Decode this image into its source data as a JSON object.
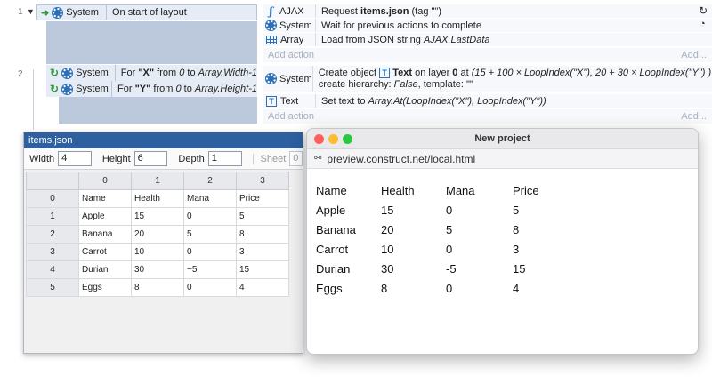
{
  "event1": {
    "number": "1",
    "condition": {
      "object": "System",
      "text": "On start of layout"
    },
    "actions": [
      {
        "object": "AJAX",
        "text_prefix": "Request ",
        "text_bold": "items.json",
        "text_suffix": " (tag \"\")"
      },
      {
        "object": "System",
        "text": "Wait for previous actions to complete"
      },
      {
        "object": "Array",
        "text_prefix": "Load from JSON string ",
        "text_italic": "AJAX.LastData"
      }
    ],
    "add_action": "Add action",
    "add_short": "Add..."
  },
  "event2": {
    "number": "2",
    "conditions": [
      {
        "object": "System",
        "p1": "For ",
        "bold": "\"X\"",
        "p2": " from ",
        "it1": "0",
        "p3": " to ",
        "it2": "Array.Width-1"
      },
      {
        "object": "System",
        "p1": "For ",
        "bold": "\"Y\"",
        "p2": " from ",
        "it1": "0",
        "p3": " to ",
        "it2": "Array.Height-1"
      }
    ],
    "actions": [
      {
        "object": "System",
        "line1_a": "Create object ",
        "line1_b": "Text",
        "line1_c": " on layer ",
        "line1_d": "0",
        "line1_e": " at ",
        "line1_f": "(15 + 100 × LoopIndex(\"X\"), 20 + 30 × LoopIndex(\"Y\") )",
        "line1_g": ",",
        "line2_a": "create hierarchy: ",
        "line2_b": "False",
        "line2_c": ", template: \"\""
      },
      {
        "object": "Text",
        "text_prefix": "Set text to ",
        "text_italic": "Array.At(LoopIndex(\"X\"), LoopIndex(\"Y\"))"
      }
    ],
    "add_action": "Add action",
    "add_short": "Add..."
  },
  "array_editor": {
    "title": "items.json",
    "width_label": "Width",
    "width_value": "4",
    "height_label": "Height",
    "height_value": "6",
    "depth_label": "Depth",
    "depth_value": "1",
    "sheet_label": "Sheet",
    "sheet_value": "0",
    "columns": [
      "0",
      "1",
      "2",
      "3"
    ],
    "rows": [
      {
        "index": "0",
        "cells": [
          "Name",
          "Health",
          "Mana",
          "Price"
        ]
      },
      {
        "index": "1",
        "cells": [
          "Apple",
          "15",
          "0",
          "5"
        ]
      },
      {
        "index": "2",
        "cells": [
          "Banana",
          "20",
          "5",
          "8"
        ]
      },
      {
        "index": "3",
        "cells": [
          "Carrot",
          "10",
          "0",
          "3"
        ]
      },
      {
        "index": "4",
        "cells": [
          "Durian",
          "30",
          "−5",
          "15"
        ]
      },
      {
        "index": "5",
        "cells": [
          "Eggs",
          "8",
          "0",
          "4"
        ]
      }
    ]
  },
  "preview": {
    "title": "New project",
    "url": "preview.construct.net/local.html",
    "table": [
      [
        "Name",
        "Health",
        "Mana",
        "Price"
      ],
      [
        "Apple",
        "15",
        "0",
        "5"
      ],
      [
        "Banana",
        "20",
        "5",
        "8"
      ],
      [
        "Carrot",
        "10",
        "0",
        "3"
      ],
      [
        "Durian",
        "30",
        "-5",
        "15"
      ],
      [
        "Eggs",
        "8",
        "0",
        "4"
      ]
    ]
  },
  "colors": {
    "titlebar_blue": "#2e5f9e",
    "system_icon": "#2c6fb5",
    "loop_icon": "#2e9a3c",
    "close_dot": "#ff5f57",
    "min_dot": "#febc2e",
    "max_dot": "#28c840"
  }
}
